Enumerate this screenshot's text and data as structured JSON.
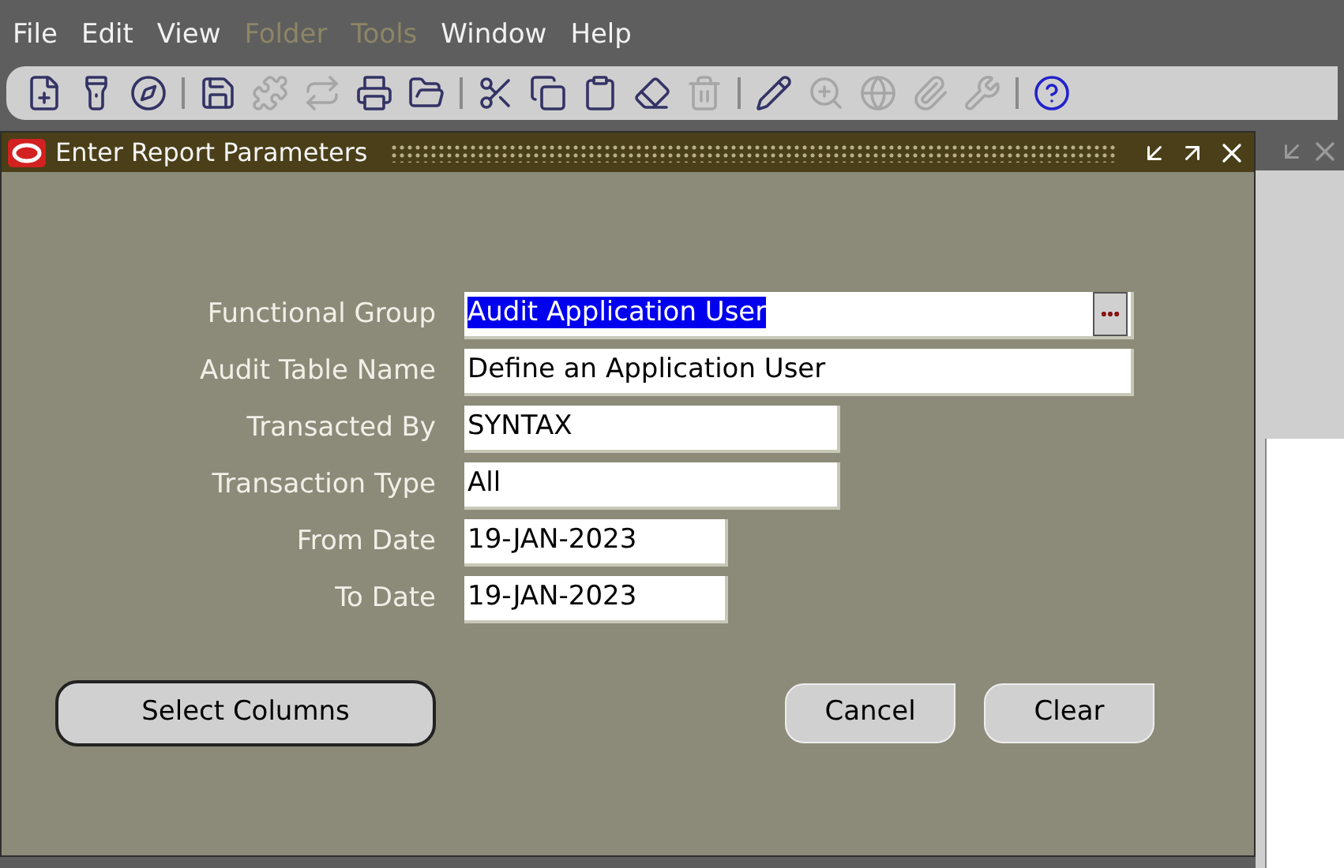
{
  "menu": [
    {
      "label": "File",
      "disabled": false
    },
    {
      "label": "Edit",
      "disabled": false
    },
    {
      "label": "View",
      "disabled": false
    },
    {
      "label": "Folder",
      "disabled": true
    },
    {
      "label": "Tools",
      "disabled": true
    },
    {
      "label": "Window",
      "disabled": false
    },
    {
      "label": "Help",
      "disabled": false
    }
  ],
  "toolbar": [
    {
      "kind": "new",
      "disabled": false
    },
    {
      "kind": "find",
      "disabled": false
    },
    {
      "kind": "navigate",
      "disabled": false
    },
    {
      "kind": "separator"
    },
    {
      "kind": "save",
      "disabled": false
    },
    {
      "kind": "next-step",
      "disabled": true
    },
    {
      "kind": "switch",
      "disabled": true
    },
    {
      "kind": "print",
      "disabled": false
    },
    {
      "kind": "close-form",
      "disabled": false
    },
    {
      "kind": "separator"
    },
    {
      "kind": "cut",
      "disabled": false
    },
    {
      "kind": "copy",
      "disabled": false
    },
    {
      "kind": "paste",
      "disabled": false
    },
    {
      "kind": "clear-record",
      "disabled": false
    },
    {
      "kind": "delete",
      "disabled": true
    },
    {
      "kind": "separator"
    },
    {
      "kind": "edit-field",
      "disabled": false
    },
    {
      "kind": "zoom",
      "disabled": true
    },
    {
      "kind": "translations",
      "disabled": true
    },
    {
      "kind": "attachments",
      "disabled": true
    },
    {
      "kind": "folder-tools",
      "disabled": true
    },
    {
      "kind": "separator"
    },
    {
      "kind": "help",
      "disabled": false
    }
  ],
  "dialog": {
    "title": "Enter Report Parameters",
    "fields": [
      {
        "label": "Functional Group",
        "value": "Audit Application User",
        "kind": "wide",
        "selected": true,
        "lov": true
      },
      {
        "label": "Audit Table Name",
        "value": "Define an Application User",
        "kind": "wide",
        "selected": false,
        "lov": false
      },
      {
        "label": "Transacted By",
        "value": "SYNTAX",
        "kind": "medium",
        "selected": false,
        "lov": false
      },
      {
        "label": "Transaction Type",
        "value": "All",
        "kind": "medium",
        "selected": false,
        "lov": false
      },
      {
        "label": "From Date",
        "value": "19-JAN-2023",
        "kind": "short",
        "selected": false,
        "lov": false
      },
      {
        "label": "To Date",
        "value": "19-JAN-2023",
        "kind": "short",
        "selected": false,
        "lov": false
      }
    ],
    "buttons": [
      {
        "label": "Select Columns",
        "kind": "pill"
      },
      {
        "label": "Cancel",
        "kind": "tab"
      },
      {
        "label": "Clear",
        "kind": "tab"
      }
    ]
  }
}
